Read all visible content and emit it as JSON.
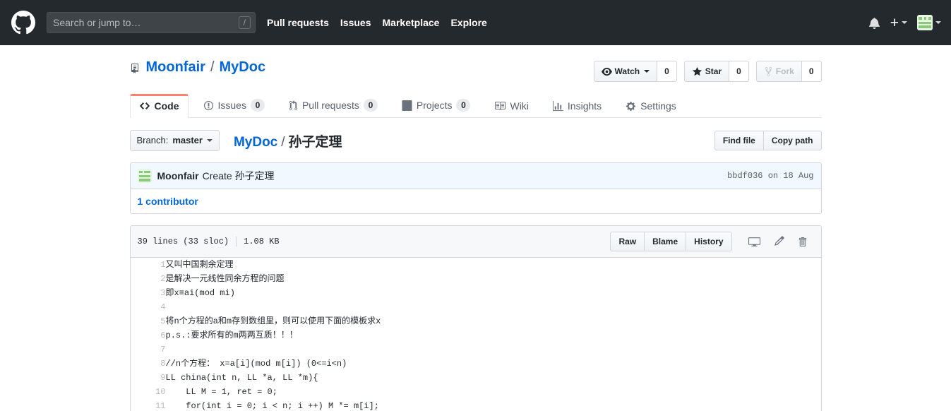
{
  "header": {
    "logo_icon": "github-mark-icon",
    "search": {
      "placeholder": "Search or jump to…",
      "value": "",
      "shortcut_key": "/"
    },
    "nav": [
      {
        "label": "Pull requests",
        "name": "pull-requests"
      },
      {
        "label": "Issues",
        "name": "issues"
      },
      {
        "label": "Marketplace",
        "name": "marketplace"
      },
      {
        "label": "Explore",
        "name": "explore"
      }
    ],
    "notifications_icon": "bell-icon",
    "create_new": {
      "label": "+",
      "icon": "plus-icon"
    },
    "avatar": {
      "icon": "user-avatar",
      "color": "#8ac97a"
    }
  },
  "repo": {
    "icon": "repo-book-icon",
    "owner": "Moonfair",
    "separator": "/",
    "name": "MyDoc",
    "actions": [
      {
        "name": "watch",
        "label": "Watch",
        "icon": "eye-icon",
        "count": "0",
        "has_caret": true,
        "disabled": false
      },
      {
        "name": "star",
        "label": "Star",
        "icon": "star-icon",
        "count": "0",
        "has_caret": false,
        "disabled": false
      },
      {
        "name": "fork",
        "label": "Fork",
        "icon": "fork-icon",
        "count": "0",
        "has_caret": false,
        "disabled": true
      }
    ]
  },
  "tabs": [
    {
      "name": "code",
      "label": "Code",
      "icon": "code-icon",
      "count": null,
      "selected": true
    },
    {
      "name": "issues",
      "label": "Issues",
      "icon": "issue-opened-icon",
      "count": "0",
      "selected": false
    },
    {
      "name": "pull-requests",
      "label": "Pull requests",
      "icon": "git-pull-request-icon",
      "count": "0",
      "selected": false
    },
    {
      "name": "projects",
      "label": "Projects",
      "icon": "project-board-icon",
      "count": "0",
      "selected": false
    },
    {
      "name": "wiki",
      "label": "Wiki",
      "icon": "book-icon",
      "count": null,
      "selected": false
    },
    {
      "name": "insights",
      "label": "Insights",
      "icon": "graph-icon",
      "count": null,
      "selected": false
    },
    {
      "name": "settings",
      "label": "Settings",
      "icon": "gear-icon",
      "count": null,
      "selected": false
    }
  ],
  "file_nav": {
    "branch_prefix": "Branch:",
    "branch_name": "master",
    "breadcrumb_root": "MyDoc",
    "breadcrumb_separator": "/",
    "breadcrumb_current": "孙子定理",
    "find_file_label": "Find file",
    "copy_path_label": "Copy path"
  },
  "commit": {
    "author": "Moonfair",
    "message": "Create 孙子定理",
    "sha": "bbdf036",
    "date": "on 18 Aug",
    "meta": "bbdf036 on 18 Aug",
    "contributors_count": "1",
    "contributors_label": "contributor",
    "contributors_text": "1 contributor"
  },
  "file": {
    "lines_text": "39 lines (33 sloc)",
    "size_text": "1.08 KB",
    "buttons": [
      {
        "name": "raw",
        "label": "Raw"
      },
      {
        "name": "blame",
        "label": "Blame"
      },
      {
        "name": "history",
        "label": "History"
      }
    ],
    "icons": [
      {
        "name": "open-in-desktop-icon"
      },
      {
        "name": "edit-pencil-icon"
      },
      {
        "name": "delete-trash-icon"
      }
    ],
    "code_lines": [
      {
        "n": "1",
        "text": "又叫中国剩余定理"
      },
      {
        "n": "2",
        "text": "是解决一元线性同余方程的问题"
      },
      {
        "n": "3",
        "text": "即x≡ai(mod mi)"
      },
      {
        "n": "4",
        "text": ""
      },
      {
        "n": "5",
        "text": "将n个方程的a和m存到数组里，则可以使用下面的模板求x"
      },
      {
        "n": "6",
        "text": "p.s.:要求所有的m两两互质！！！"
      },
      {
        "n": "7",
        "text": ""
      },
      {
        "n": "8",
        "text": "//n个方程： x=a[i](mod m[i]) (0<=i<n)"
      },
      {
        "n": "9",
        "text": "LL china(int n, LL *a, LL *m){"
      },
      {
        "n": "10",
        "text": "    LL M = 1, ret = 0;"
      },
      {
        "n": "11",
        "text": "    for(int i = 0; i < n; i ++) M *= m[i];"
      }
    ]
  },
  "colors": {
    "header_bg": "#24292e",
    "link": "#0366d6",
    "tab_accent": "#f9826c",
    "commit_bg": "#f1f8ff",
    "border": "#d1d5da"
  }
}
